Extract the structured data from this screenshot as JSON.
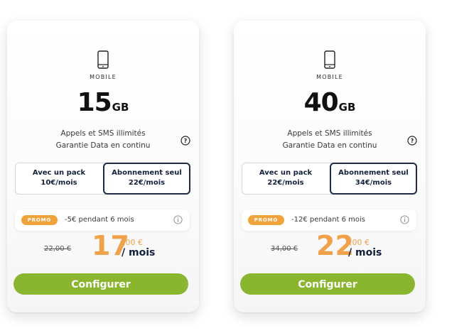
{
  "cards": [
    {
      "category": "MOBILE",
      "data_amount": "15",
      "data_unit": "GB",
      "features": [
        "Appels et SMS illimités",
        "Garantie Data en continu"
      ],
      "options": [
        {
          "label": "Avec un pack",
          "price": "10€/mois",
          "selected": false
        },
        {
          "label": "Abonnement seul",
          "price": "22€/mois",
          "selected": true
        }
      ],
      "promo_badge": "PROMO",
      "promo_text": "-5€ pendant 6 mois",
      "old_price": "22,00 €",
      "price_int": "17",
      "price_cents": ",00 €",
      "price_period": "/ mois",
      "cta_label": "Configurer"
    },
    {
      "category": "MOBILE",
      "data_amount": "40",
      "data_unit": "GB",
      "features": [
        "Appels et SMS illimités",
        "Garantie Data en continu"
      ],
      "options": [
        {
          "label": "Avec un pack",
          "price": "22€/mois",
          "selected": false
        },
        {
          "label": "Abonnement seul",
          "price": "34€/mois",
          "selected": true
        }
      ],
      "promo_badge": "PROMO",
      "promo_text": "-12€ pendant 6 mois",
      "old_price": "34,00 €",
      "price_int": "22",
      "price_cents": ",00 €",
      "price_period": "/ mois",
      "cta_label": "Configurer"
    }
  ],
  "icons": {
    "category": "mobile-phone-icon",
    "help": "question-circle-icon",
    "info": "info-circle-icon"
  },
  "colors": {
    "accent_orange": "#f0a24a",
    "promo_orange": "#f0a23b",
    "cta_green": "#8ab52f",
    "navy": "#14213d"
  }
}
